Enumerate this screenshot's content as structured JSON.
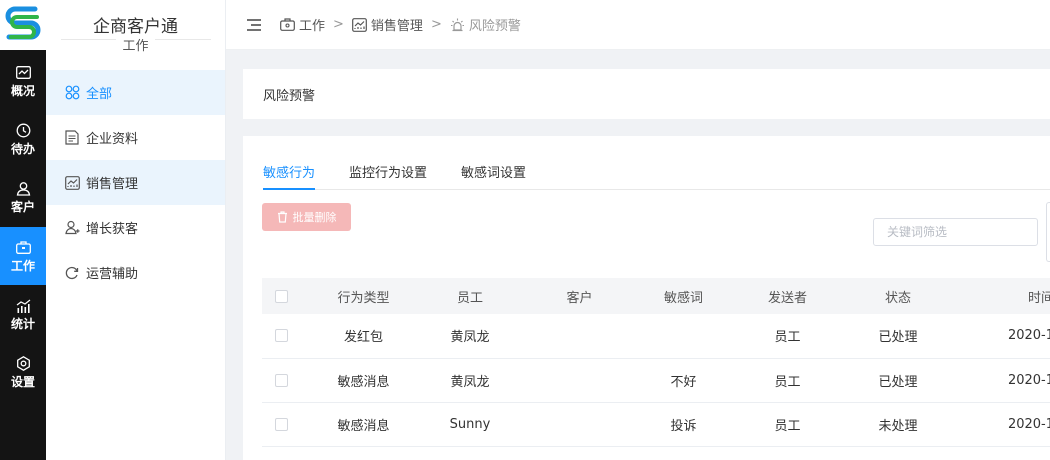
{
  "app": {
    "name": "企商客户通",
    "section": "工作"
  },
  "rail": [
    {
      "label": "概况",
      "icon": "line-chart-icon"
    },
    {
      "label": "待办",
      "icon": "clock-icon"
    },
    {
      "label": "客户",
      "icon": "user-icon"
    },
    {
      "label": "工作",
      "icon": "briefcase-icon",
      "active": true
    },
    {
      "label": "统计",
      "icon": "bar-chart-icon"
    },
    {
      "label": "设置",
      "icon": "gear-icon"
    }
  ],
  "sidebar": {
    "items": [
      {
        "label": "全部",
        "icon": "grid-icon",
        "state": "highlighted"
      },
      {
        "label": "企业资料",
        "icon": "document-icon"
      },
      {
        "label": "销售管理",
        "icon": "sales-chart-icon",
        "state": "active"
      },
      {
        "label": "增长获客",
        "icon": "users-icon"
      },
      {
        "label": "运营辅助",
        "icon": "refresh-icon"
      }
    ]
  },
  "breadcrumb": [
    {
      "label": "工作",
      "icon": "briefcase-icon"
    },
    {
      "label": "销售管理",
      "icon": "sales-chart-icon"
    },
    {
      "label": "风险预警",
      "icon": "alarm-icon"
    }
  ],
  "breadcrumb_separator": ">",
  "page": {
    "title": "风险预警"
  },
  "tabs": [
    {
      "label": "敏感行为",
      "active": true
    },
    {
      "label": "监控行为设置"
    },
    {
      "label": "敏感词设置"
    }
  ],
  "toolbar": {
    "batch_delete_label": "批量删除",
    "search_placeholder": "关键词筛选"
  },
  "table": {
    "columns": [
      "行为类型",
      "员工",
      "客户",
      "敏感词",
      "发送者",
      "状态",
      "时间"
    ],
    "rows": [
      {
        "type": "发红包",
        "employee": "黄凤龙",
        "customer": "",
        "word": "",
        "sender": "员工",
        "status": "已处理",
        "date": "2020-1"
      },
      {
        "type": "敏感消息",
        "employee": "黄凤龙",
        "customer": "",
        "word": "不好",
        "sender": "员工",
        "status": "已处理",
        "date": "2020-1"
      },
      {
        "type": "敏感消息",
        "employee": "Sunny",
        "customer": "",
        "word": "投诉",
        "sender": "员工",
        "status": "未处理",
        "date": "2020-1"
      }
    ]
  },
  "colors": {
    "accent": "#1890ff",
    "rail_bg": "#141414",
    "danger_light": "#f5b8b8"
  }
}
